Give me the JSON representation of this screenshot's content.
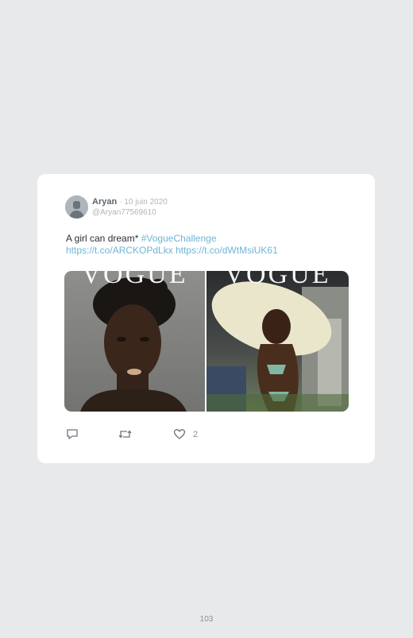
{
  "tweet": {
    "author_name": "Aryan",
    "date": "· 10 juin 2020",
    "handle": "@Aryan77569610",
    "text": "A girl can dream*",
    "hashtag": "#VogueChallenge",
    "link1": "https://t.co/ARCKOPdLkx",
    "link2": "https://t.co/dWtMsiUK61",
    "media": {
      "left_title": "VOGUE",
      "right_title": "VOGUE"
    },
    "like_count": "2"
  },
  "icons": {
    "avatar": "user-avatar",
    "reply": "reply-icon",
    "retweet": "retweet-icon",
    "like": "heart-icon"
  },
  "colors": {
    "link": "#6fb5d6",
    "background": "#e8e9eb",
    "card": "#ffffff"
  },
  "page": {
    "number": "103"
  }
}
